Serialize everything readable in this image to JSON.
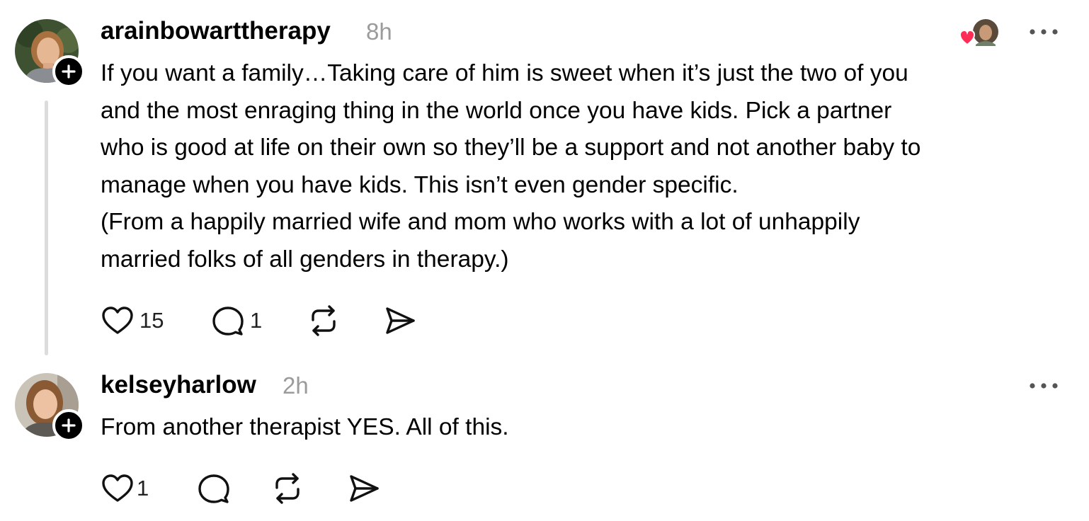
{
  "posts": [
    {
      "username": "arainbowarttherapy",
      "time": "8h",
      "lines": [
        "If you want a family…Taking care of him is sweet when it’s just the two of you",
        "and the most enraging thing in the world once you have kids. Pick a partner",
        "who is good at life on their own so they’ll be a support and not another baby to",
        "manage when you have kids. This isn’t even gender specific.",
        "(From a happily married wife and mom who works with a lot of unhappily",
        "married folks of all genders in therapy.)"
      ],
      "likes": "15",
      "replies": "1",
      "has_liker_avatars": true
    },
    {
      "username": "kelseyharlow",
      "time": "2h",
      "lines": [
        "From another therapist YES. All of this."
      ],
      "likes": "1",
      "replies": "",
      "has_liker_avatars": false
    }
  ],
  "icons": {
    "like": "heart-outline-icon",
    "reply": "speech-bubble-icon",
    "repost": "repost-arrows-icon",
    "share": "send-arrow-icon",
    "more": "ellipsis-icon",
    "follow": "plus-icon",
    "liked_badge": "red-heart-icon"
  },
  "colors": {
    "text": "#000000",
    "muted": "#9b9b9b",
    "thread_line": "#dcdcdc",
    "like_badge": "#ff2d55"
  }
}
